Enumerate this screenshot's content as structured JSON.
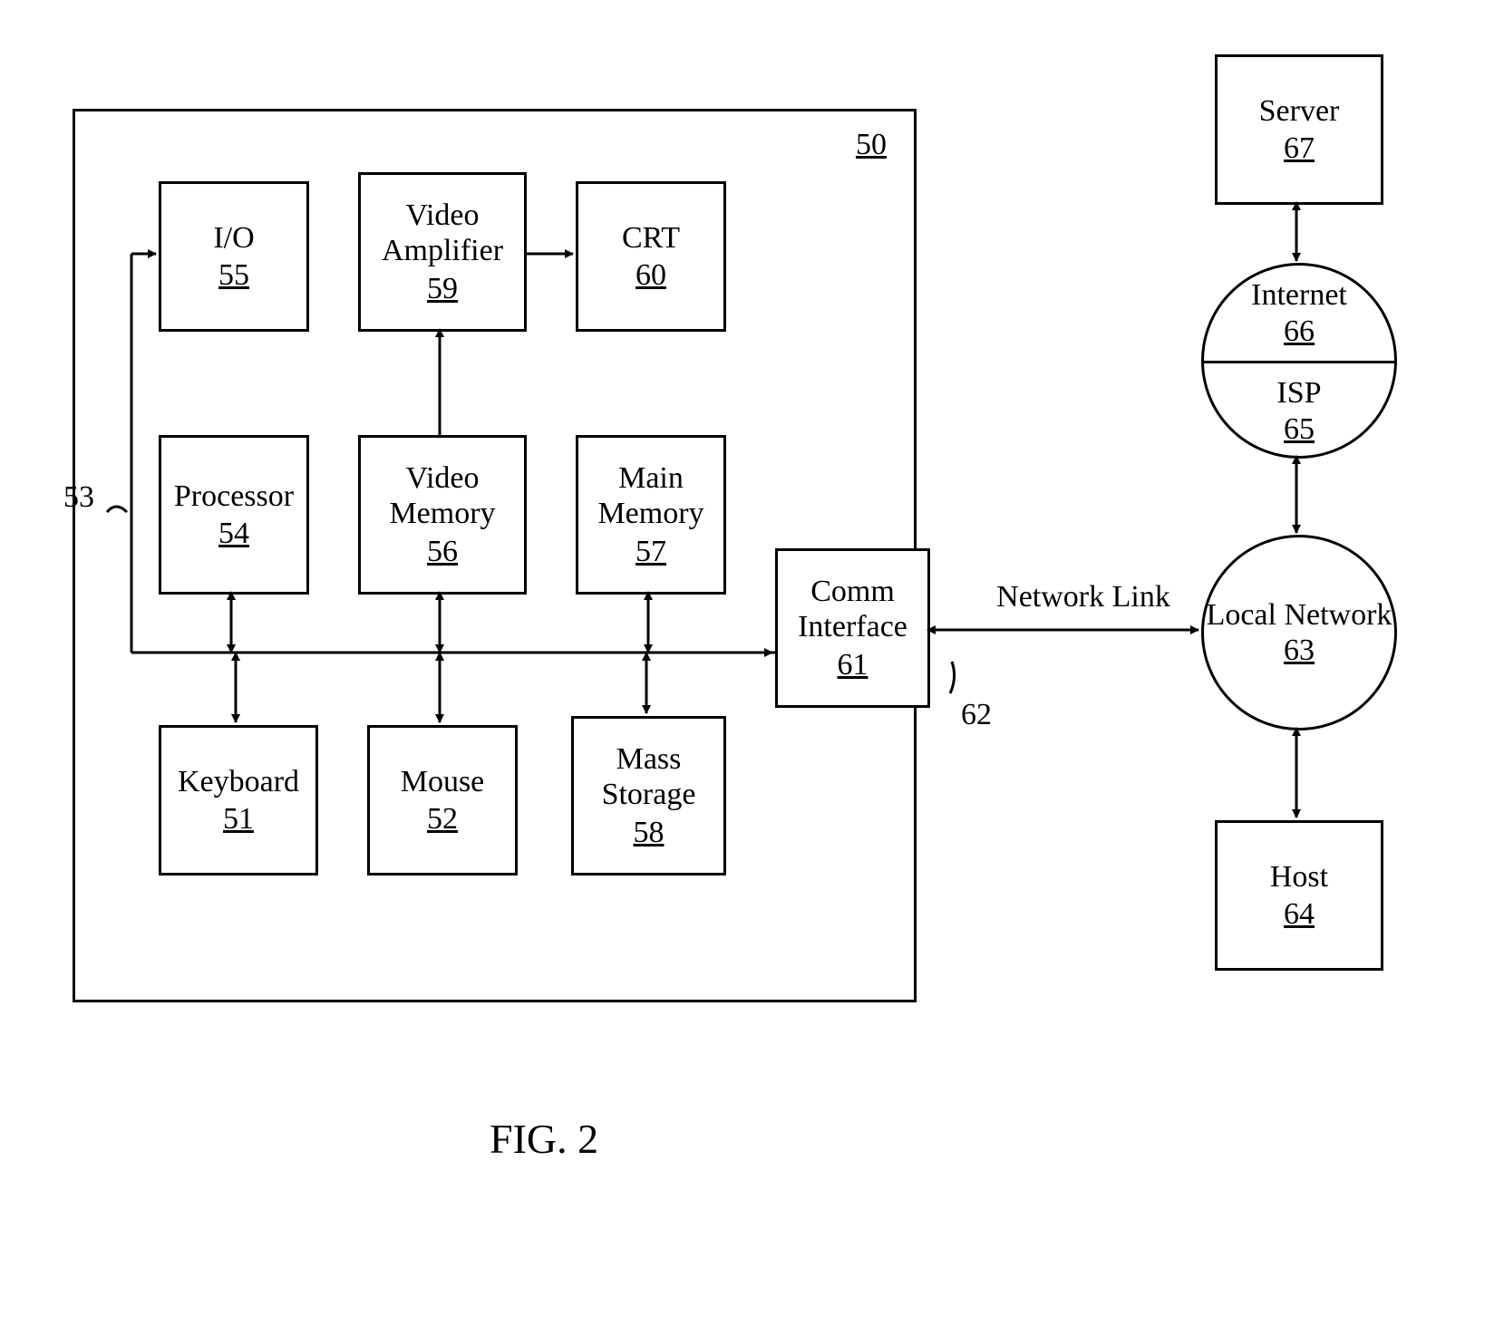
{
  "figure_caption": "FIG. 2",
  "frame": {
    "num": "50"
  },
  "bus_label": "53",
  "network_link_label": "Network Link",
  "network_link_num": "62",
  "blocks": {
    "io": {
      "label": "I/O",
      "num": "55"
    },
    "videoamp": {
      "label": "Video Amplifier",
      "num": "59"
    },
    "crt": {
      "label": "CRT",
      "num": "60"
    },
    "processor": {
      "label": "Processor",
      "num": "54"
    },
    "videomem": {
      "label": "Video Memory",
      "num": "56"
    },
    "mainmem": {
      "label": "Main Memory",
      "num": "57"
    },
    "comm": {
      "label": "Comm Interface",
      "num": "61"
    },
    "keyboard": {
      "label": "Keyboard",
      "num": "51"
    },
    "mouse": {
      "label": "Mouse",
      "num": "52"
    },
    "mass": {
      "label": "Mass Storage",
      "num": "58"
    },
    "server": {
      "label": "Server",
      "num": "67"
    },
    "host": {
      "label": "Host",
      "num": "64"
    },
    "localnet": {
      "label": "Local Network",
      "num": "63"
    },
    "internet": {
      "label": "Internet",
      "num": "66"
    },
    "isp": {
      "label": "ISP",
      "num": "65"
    }
  }
}
